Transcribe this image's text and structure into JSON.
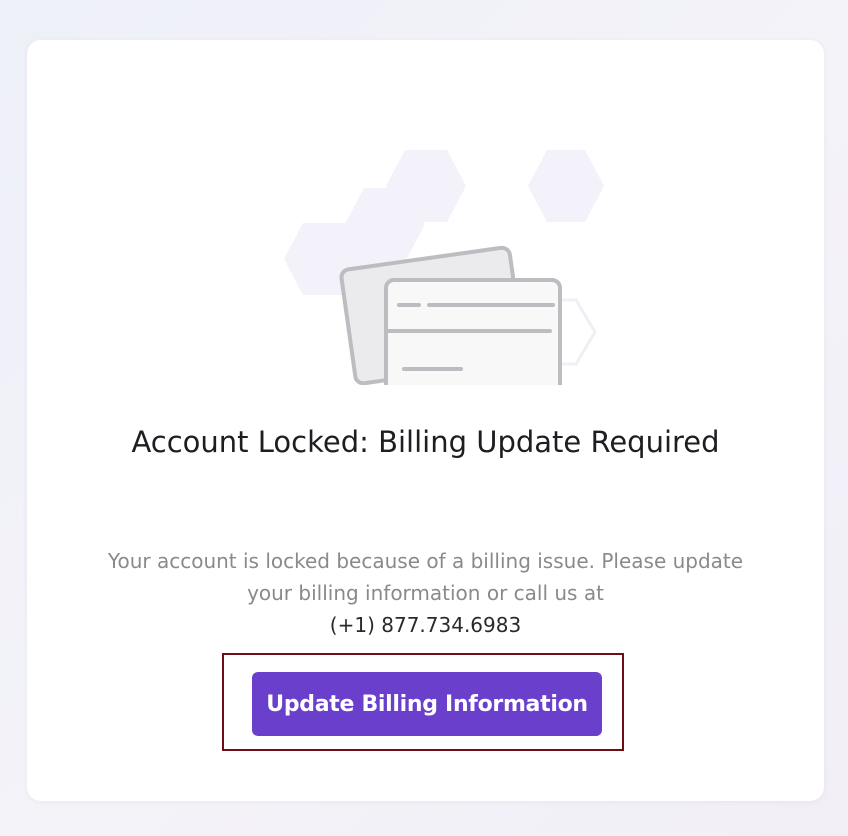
{
  "modal": {
    "title": "Account Locked: Billing Update Required",
    "message": "Your account is locked because of a billing issue. Please update your billing information or call us at",
    "phone": "(+1) 877.734.6983",
    "button_label": "Update Billing Information"
  },
  "illustration": {
    "icon": "credit-card-icon",
    "accent_color": "#b4b0f0",
    "hexagon_color": "#f3f2fb"
  },
  "colors": {
    "primary": "#6a3fcb",
    "highlight_outline": "#6e0d14"
  }
}
